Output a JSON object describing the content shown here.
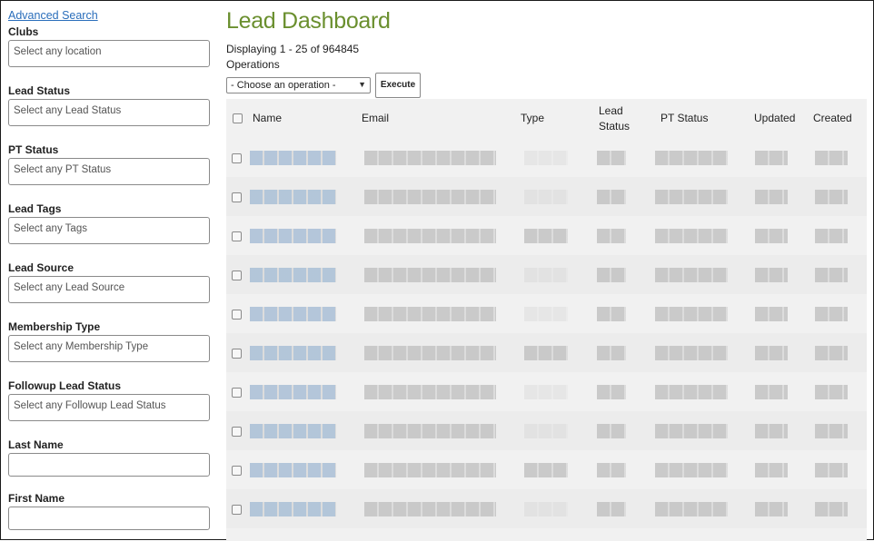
{
  "sidebar": {
    "advanced_search": "Advanced Search",
    "filters": [
      {
        "label": "Clubs",
        "placeholder": "Select any location"
      },
      {
        "label": "Lead Status",
        "placeholder": "Select any Lead Status"
      },
      {
        "label": "PT Status",
        "placeholder": "Select any PT Status"
      },
      {
        "label": "Lead Tags",
        "placeholder": "Select any Tags"
      },
      {
        "label": "Lead Source",
        "placeholder": "Select any Lead Source"
      },
      {
        "label": "Membership Type",
        "placeholder": "Select any Membership Type"
      },
      {
        "label": "Followup Lead Status",
        "placeholder": "Select any Followup Lead Status"
      }
    ],
    "text_fields": [
      {
        "label": "Last Name",
        "value": ""
      },
      {
        "label": "First Name",
        "value": ""
      }
    ]
  },
  "main": {
    "title": "Lead Dashboard",
    "display_count": "Displaying 1 - 25 of 964845",
    "operations_label": "Operations",
    "operation_select": "- Choose an operation -",
    "execute_label": "Execute",
    "columns": [
      "Name",
      "Email",
      "Type",
      "Lead Status",
      "PT Status",
      "Updated",
      "Created"
    ],
    "colors": {
      "title": "#6a8f2e",
      "link": "#2a6ebb",
      "blurred_name": "#a9bfd6",
      "blurred_text": "#c3c3c3"
    }
  }
}
